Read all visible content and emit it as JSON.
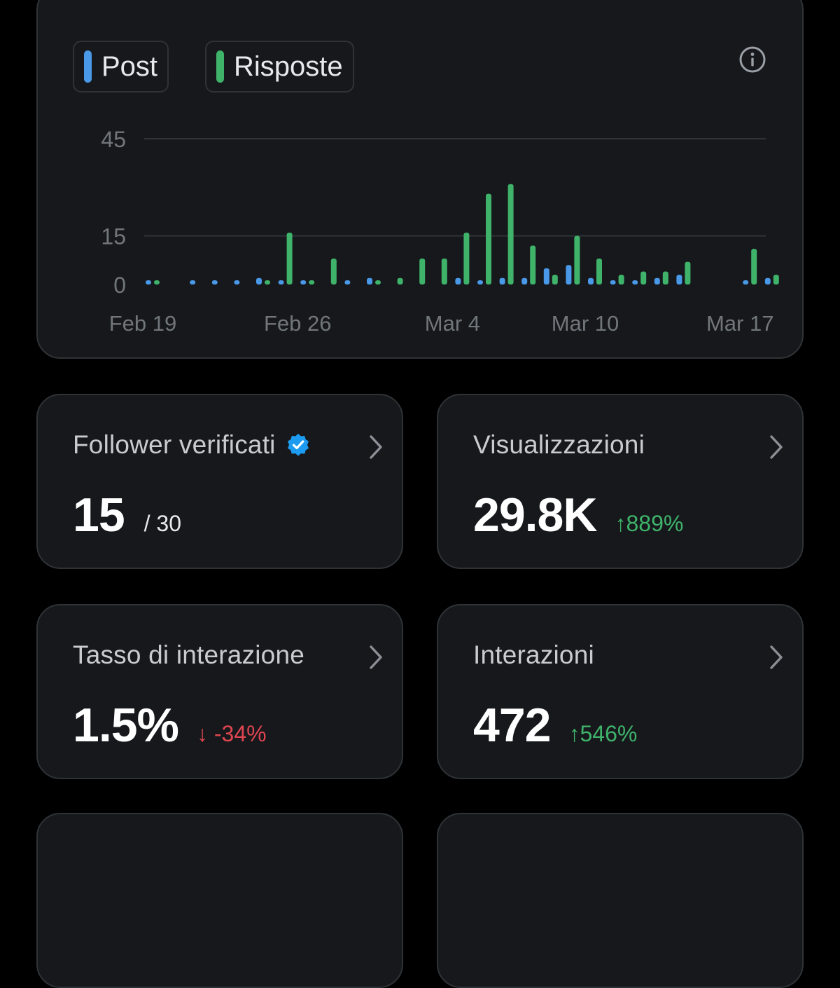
{
  "colors": {
    "post": "#4a99e9",
    "replies": "#3fb36a",
    "up": "#3fb36a",
    "down": "#e04550",
    "verified": "#1d9bf0"
  },
  "legend": {
    "post_label": "Post",
    "replies_label": "Risposte"
  },
  "chart_data": {
    "type": "bar",
    "title": "",
    "xlabel": "",
    "ylabel": "",
    "ylim": [
      0,
      45
    ],
    "yticks": [
      0,
      15,
      45
    ],
    "x_tick_labels": [
      "Feb 19",
      "Feb 26",
      "Mar 4",
      "Mar 10",
      "Mar 17"
    ],
    "categories": [
      "Feb 19",
      "Feb 20",
      "Feb 21",
      "Feb 22",
      "Feb 23",
      "Feb 24",
      "Feb 25",
      "Feb 26",
      "Feb 27",
      "Feb 28",
      "Feb 29",
      "Mar 1",
      "Mar 2",
      "Mar 3",
      "Mar 4",
      "Mar 5",
      "Mar 6",
      "Mar 7",
      "Mar 8",
      "Mar 9",
      "Mar 10",
      "Mar 11",
      "Mar 12",
      "Mar 13",
      "Mar 14",
      "Mar 15",
      "Mar 16",
      "Mar 17",
      "Mar 18"
    ],
    "series": [
      {
        "name": "Post",
        "values": [
          1,
          0,
          1,
          1,
          1,
          2,
          1,
          1,
          0,
          1,
          2,
          0,
          0,
          0,
          2,
          1,
          2,
          2,
          5,
          6,
          2,
          1,
          1,
          2,
          3,
          0,
          0,
          1,
          2
        ]
      },
      {
        "name": "Risposte",
        "values": [
          1,
          0,
          0,
          0,
          0,
          1,
          16,
          1,
          8,
          0,
          1,
          2,
          8,
          8,
          16,
          28,
          31,
          12,
          3,
          15,
          8,
          3,
          4,
          4,
          7,
          0,
          0,
          11,
          3
        ]
      }
    ]
  },
  "cards": [
    {
      "title": "Follower verificati",
      "value": "15",
      "sub": "/ 30",
      "change": "",
      "trend": ""
    },
    {
      "title": "Visualizzazioni",
      "value": "29.8K",
      "sub": "",
      "change": "889%",
      "trend": "up"
    },
    {
      "title": "Tasso di interazione",
      "value": "1.5%",
      "sub": "",
      "change": "-34%",
      "trend": "down"
    },
    {
      "title": "Interazioni",
      "value": "472",
      "sub": "",
      "change": "546%",
      "trend": "up"
    }
  ]
}
